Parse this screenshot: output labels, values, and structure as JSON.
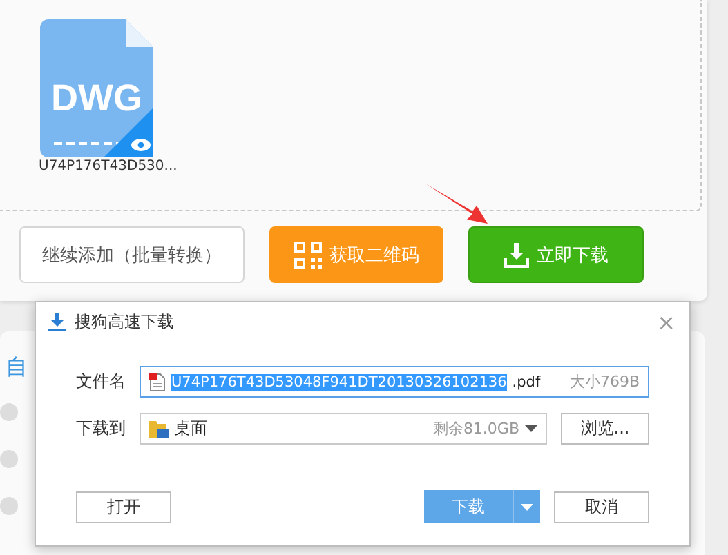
{
  "file_tile": {
    "type_label": "DWG",
    "name": "U74P176T43D530..."
  },
  "actions": [
    {
      "label": "继续添加（批量转换）",
      "kind": "outline"
    },
    {
      "label": "获取二维码",
      "kind": "qr"
    },
    {
      "label": "立即下载",
      "kind": "download"
    }
  ],
  "options": {
    "heading": "自",
    "radios": [
      {
        "selected": false
      },
      {
        "selected": false
      },
      {
        "selected": false
      }
    ]
  },
  "dialog": {
    "title": "搜狗高速下载",
    "close": "×",
    "filename_label": "文件名",
    "filename_selected": "U74P176T43D53048F941DT20130326102136",
    "filename_ext": ".pdf",
    "size": "大小769B",
    "folder_label": "下载到",
    "folder": "桌面",
    "free_space": "剩余81.0GB",
    "browse": "浏览...",
    "open": "打开",
    "download": "下载",
    "cancel": "取消"
  }
}
